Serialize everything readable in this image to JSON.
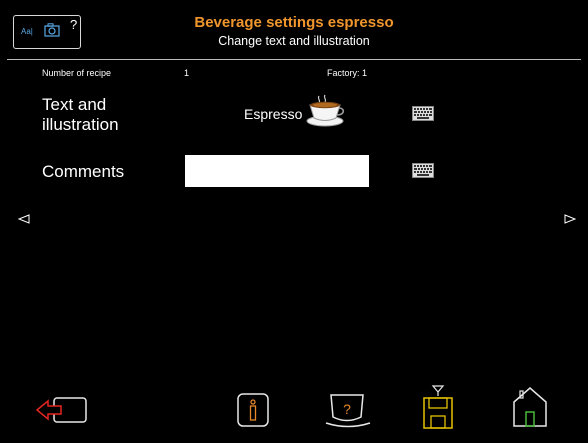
{
  "header": {
    "help_label": "?",
    "text_icon_label": "Aa|",
    "title": "Beverage settings espresso",
    "subtitle": "Change text and illustration"
  },
  "info": {
    "recipe_label": "Number of recipe",
    "recipe_value": "1",
    "factory_label": "Factory: 1"
  },
  "fields": {
    "text_label_line1": "Text and",
    "text_label_line2": "illustration",
    "beverage_name": "Espresso",
    "comments_label": "Comments",
    "comments_value": ""
  },
  "colors": {
    "accent_orange": "#f0962d",
    "exit_red": "#e2261f",
    "info_orange": "#e8872a",
    "save_yellow": "#e5c100",
    "home_green": "#49b83a",
    "header_blue": "#5aa9e6"
  },
  "icons": {
    "nav_prev": "triangle-left-icon",
    "nav_next": "triangle-right-icon",
    "exit": "exit-icon",
    "info": "info-icon",
    "cup_help": "cup-help-icon",
    "save": "save-icon",
    "home": "home-icon"
  }
}
